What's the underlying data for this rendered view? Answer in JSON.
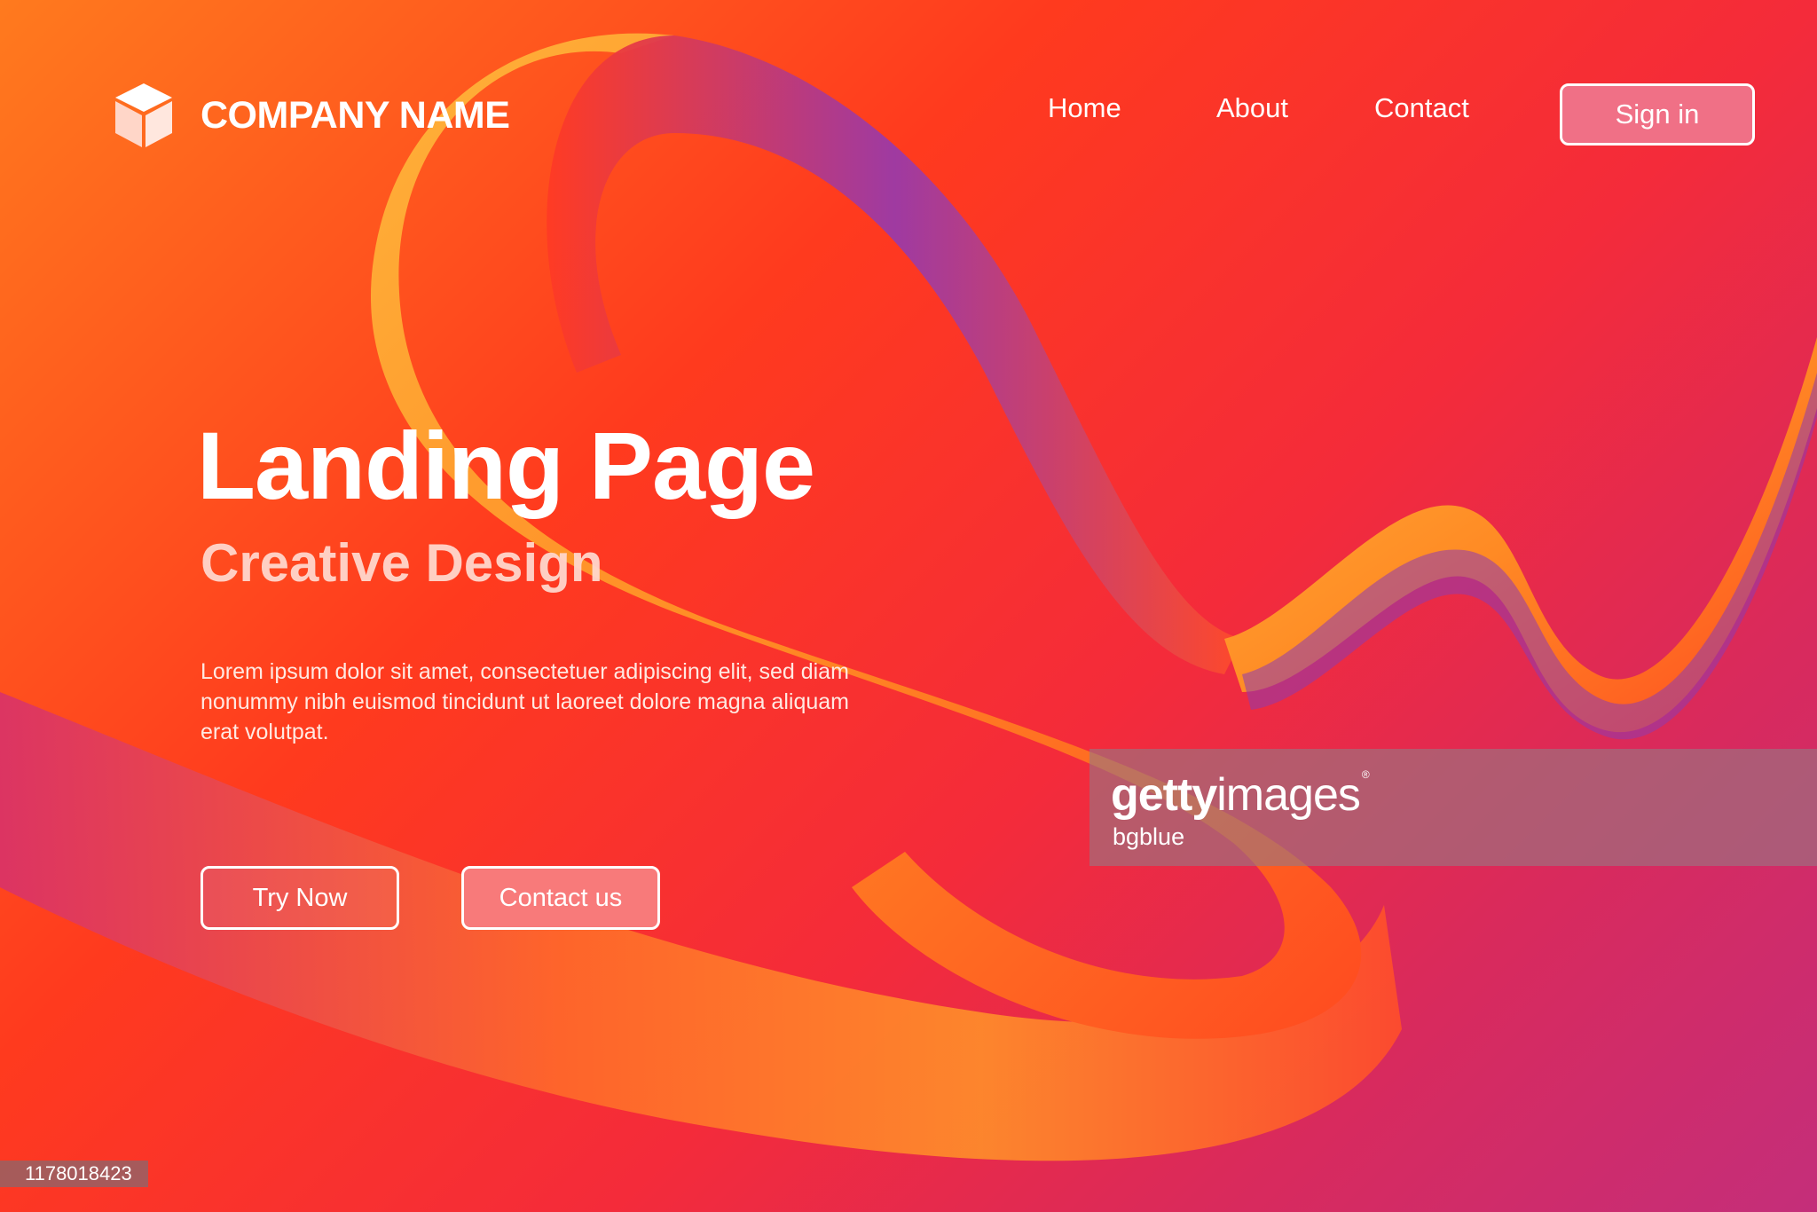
{
  "header": {
    "logo_icon": "cube-icon",
    "company_name": "COMPANY NAME",
    "nav": [
      {
        "label": "Home"
      },
      {
        "label": "About"
      },
      {
        "label": "Contact"
      }
    ],
    "signin_label": "Sign in"
  },
  "hero": {
    "title": "Landing Page",
    "subtitle": "Creative Design",
    "body": "Lorem ipsum dolor sit amet, consectetuer adipiscing elit, sed diam nonummy nibh euismod tincidunt ut laoreet dolore magna aliquam erat volutpat.",
    "primary_button": "Try Now",
    "secondary_button": "Contact us"
  },
  "watermark": {
    "brand_bold": "getty",
    "brand_light": "images",
    "registered": "®",
    "credit": "bgblue",
    "image_id": "1178018423"
  },
  "colors": {
    "background_start": "#ff7a1e",
    "background_end": "#c42e7a",
    "signin_fill": "#f07086",
    "contact_fill": "#f87a7a"
  }
}
